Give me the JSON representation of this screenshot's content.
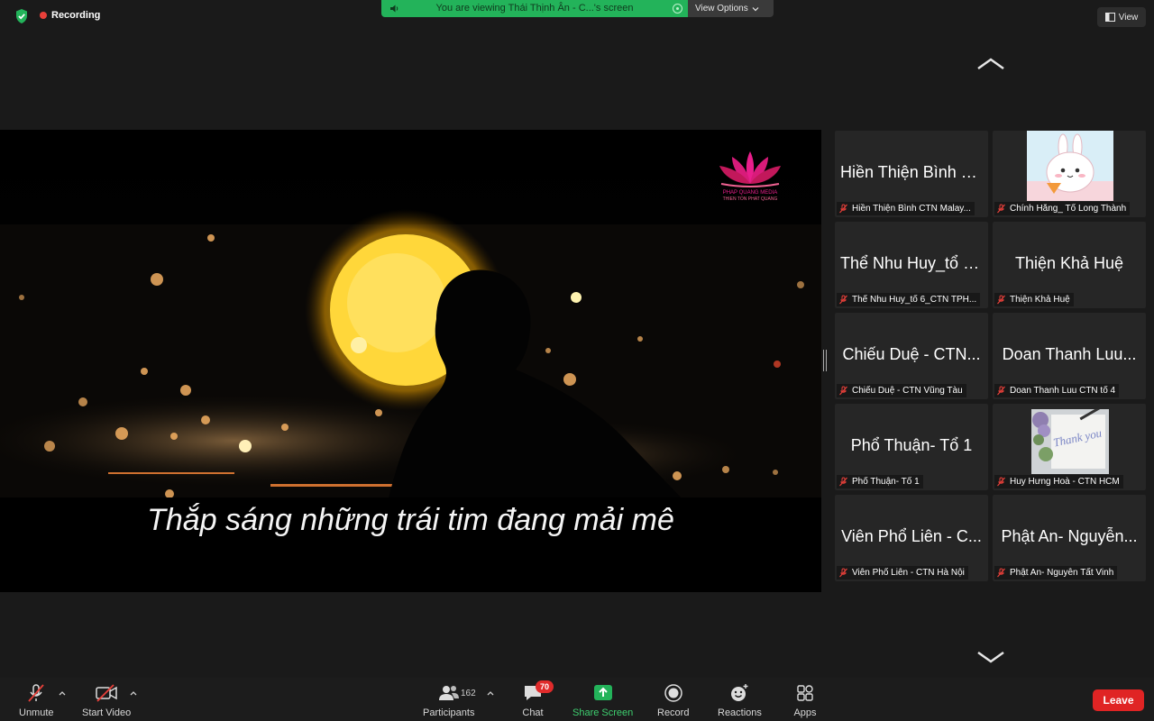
{
  "top_bar": {
    "recording_label": "Recording",
    "banner_text": "You are viewing Thái Thịnh Ân - C...'s screen",
    "view_options_label": "View Options",
    "view_label": "View"
  },
  "shared_screen": {
    "caption": "Thắp sáng những trái tim đang mải mê",
    "logo_text_line1": "PHAP QUANG MEDIA",
    "logo_text_line2": "THIEN TON PHAT QUANG"
  },
  "gallery": {
    "tiles": [
      {
        "display_name": "Hiền Thiện Bình  C...",
        "label": "Hiền Thiện Bình  CTN Malay..."
      },
      {
        "display_name": "",
        "label": "Chính Hằng_ Tổ Long Thành"
      },
      {
        "display_name": "Thể Nhu Huy_tổ 6...",
        "label": "Thể Nhu Huy_tổ 6_CTN TPH..."
      },
      {
        "display_name": "Thiện Khả Huệ",
        "label": "Thiện Khả Huệ"
      },
      {
        "display_name": "Chiếu Duệ - CTN...",
        "label": "Chiếu Duệ - CTN Vũng Tàu"
      },
      {
        "display_name": "Doan Thanh Luu...",
        "label": "Doan Thanh Luu CTN tổ 4"
      },
      {
        "display_name": "Phổ Thuận- Tổ 1",
        "label": "Phổ Thuận- Tổ 1"
      },
      {
        "display_name": "",
        "label": "Huy Hưng Hoà -  CTN HCM"
      },
      {
        "display_name": "Viên Phổ Liên - C...",
        "label": "Viên Phổ Liên - CTN Hà Nội"
      },
      {
        "display_name": "Phật An- Nguyễn...",
        "label": "Phật An- Nguyễn Tất Vinh"
      }
    ],
    "photo_text": "Thank you"
  },
  "toolbar": {
    "unmute": "Unmute",
    "start_video": "Start Video",
    "participants": "Participants",
    "participant_count": "162",
    "chat": "Chat",
    "chat_badge": "70",
    "share_screen": "Share Screen",
    "record": "Record",
    "reactions": "Reactions",
    "apps": "Apps",
    "leave": "Leave"
  },
  "colors": {
    "share_green": "#23b35a",
    "leave_red": "#e02424",
    "mute_red": "#e8403a",
    "background": "#1a1a1a"
  }
}
